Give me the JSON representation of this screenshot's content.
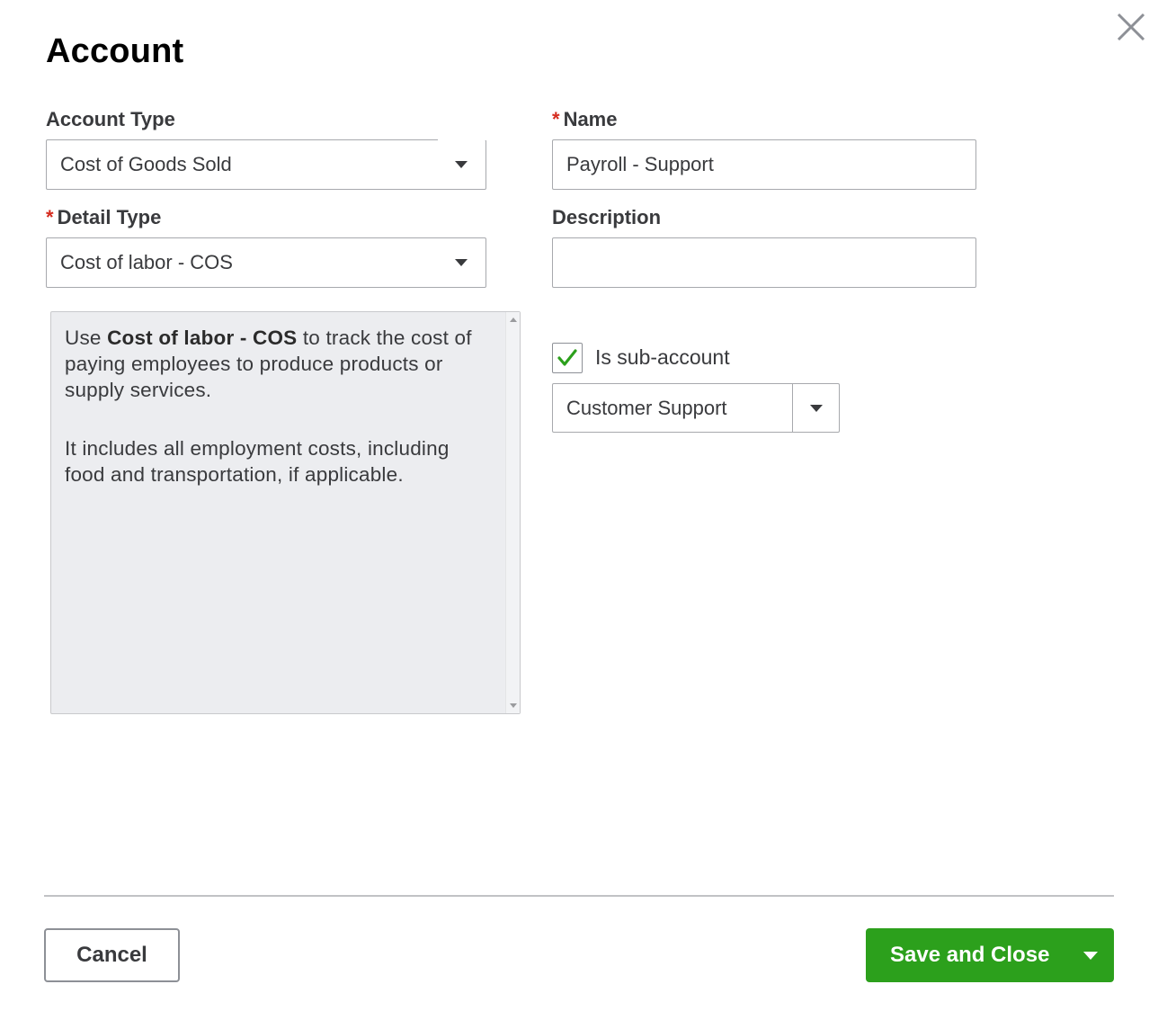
{
  "dialog": {
    "title": "Account",
    "close_icon": "close-icon"
  },
  "account_type": {
    "label": "Account Type",
    "value": "Cost of Goods Sold"
  },
  "name": {
    "required_mark": "*",
    "label": "Name",
    "value": "Payroll - Support"
  },
  "detail_type": {
    "required_mark": "*",
    "label": "Detail Type",
    "value": "Cost of labor - COS"
  },
  "description": {
    "label": "Description",
    "value": ""
  },
  "detail_help": {
    "prefix": "Use ",
    "bold_term": "Cost of labor - COS",
    "suffix": " to track the cost of paying employees to produce products or supply services.",
    "paragraph2": "It includes all employment costs, including food and transportation, if applicable."
  },
  "sub_account": {
    "checked": true,
    "label": "Is sub-account",
    "parent_value": "Customer Support",
    "check_color": "#2ca01c"
  },
  "footer": {
    "cancel_label": "Cancel",
    "save_label": "Save and Close",
    "primary_color": "#2ca01c"
  }
}
